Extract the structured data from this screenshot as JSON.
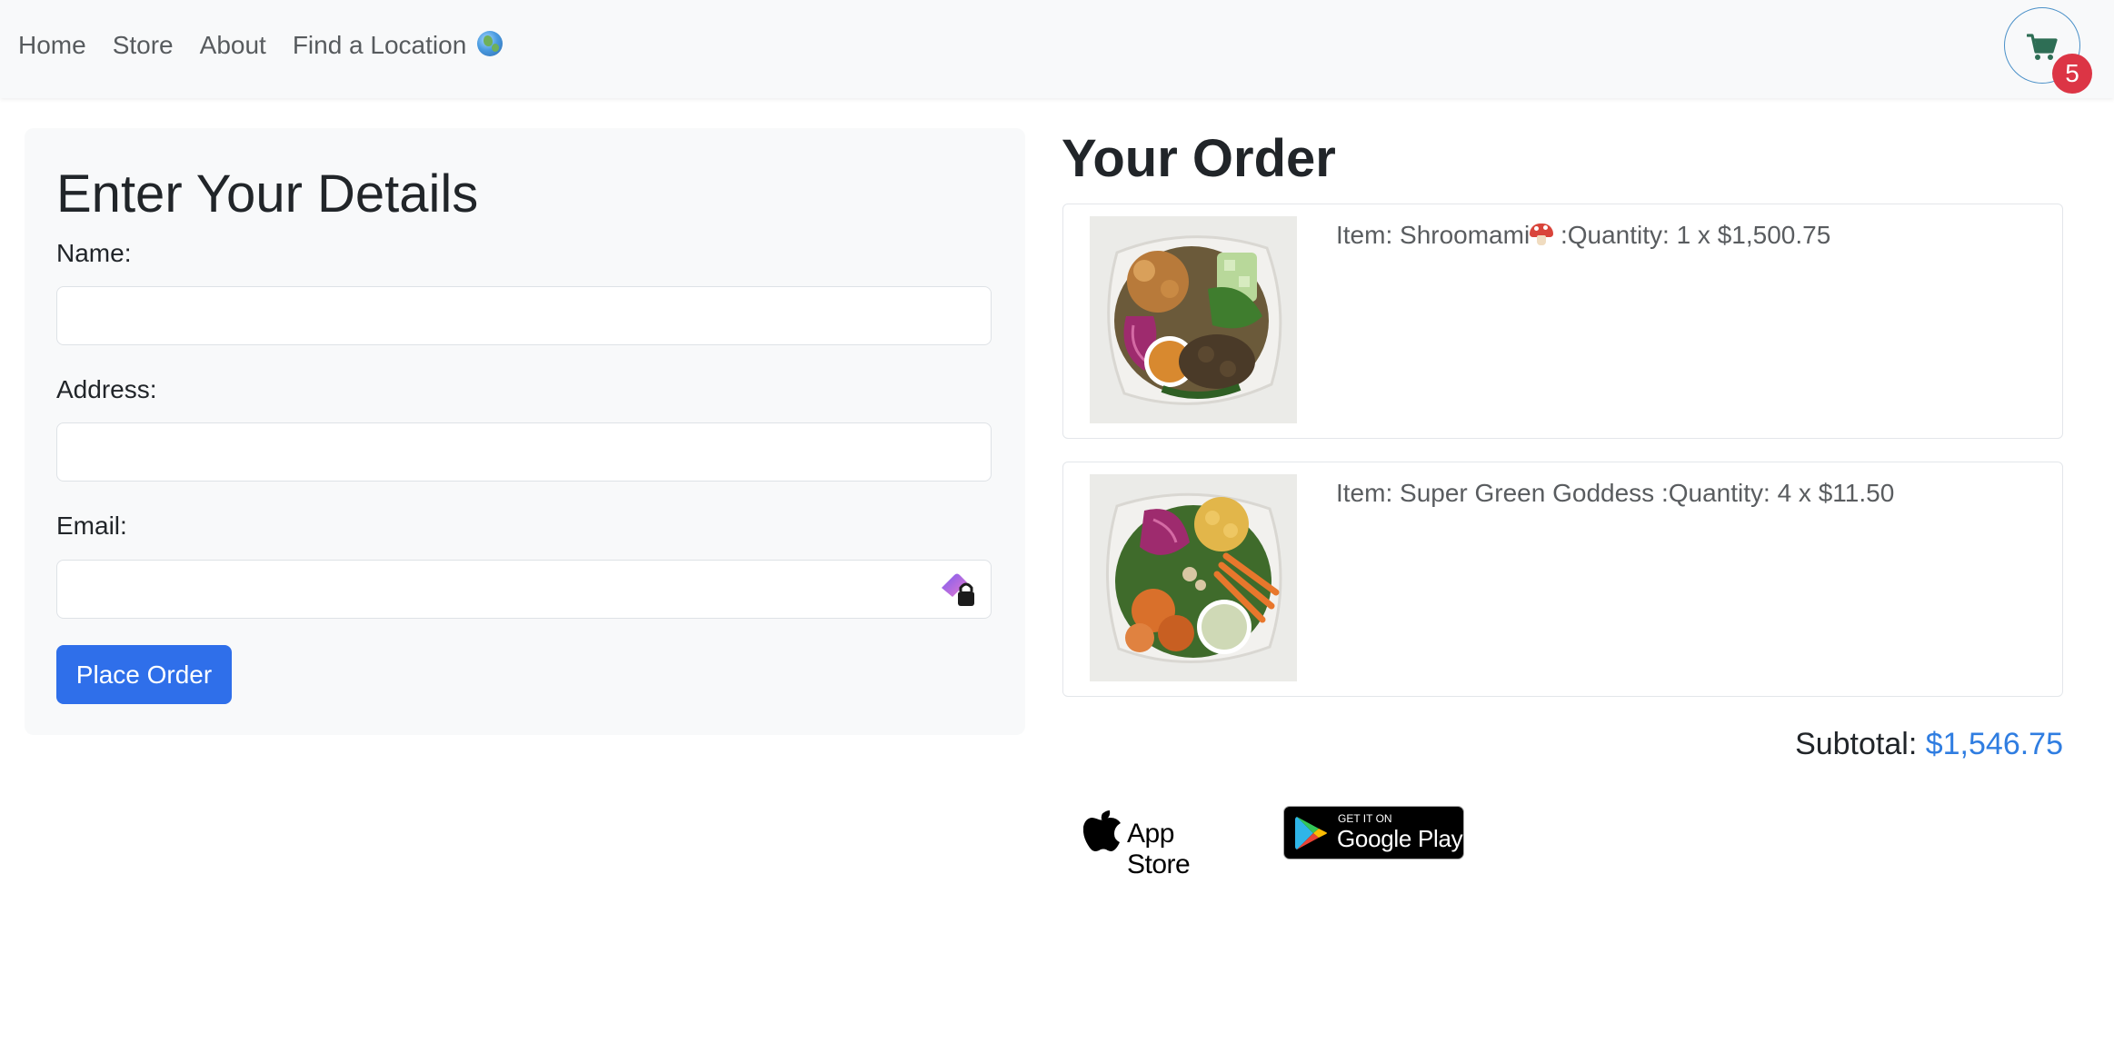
{
  "nav": {
    "links": [
      "Home",
      "Store",
      "About",
      "Find a Location"
    ],
    "cart_count": "5"
  },
  "form": {
    "title": "Enter Your Details",
    "name_label": "Name:",
    "name_value": "",
    "address_label": "Address:",
    "address_value": "",
    "email_label": "Email:",
    "email_value": "",
    "submit_label": "Place Order"
  },
  "order": {
    "title": "Your Order",
    "items": [
      {
        "prefix": "Item: Shroomami",
        "suffix": " :Quantity: 1 x $1,500.75",
        "has_mushroom_emoji": true
      },
      {
        "prefix": "Item: Super Green Goddess",
        "suffix": " :Quantity: 4 x $11.50",
        "has_mushroom_emoji": false
      }
    ],
    "subtotal_label": "Subtotal:",
    "subtotal_value": "$1,546.75"
  },
  "badges": {
    "appstore_label": "App Store",
    "googleplay_small": "GET IT ON",
    "googleplay_big": "Google Play"
  },
  "colors": {
    "primary": "#2f6fea",
    "badge": "#dc3545",
    "subtotal_accent": "#2f7de1",
    "navbar_bg": "#f8f9fa"
  }
}
